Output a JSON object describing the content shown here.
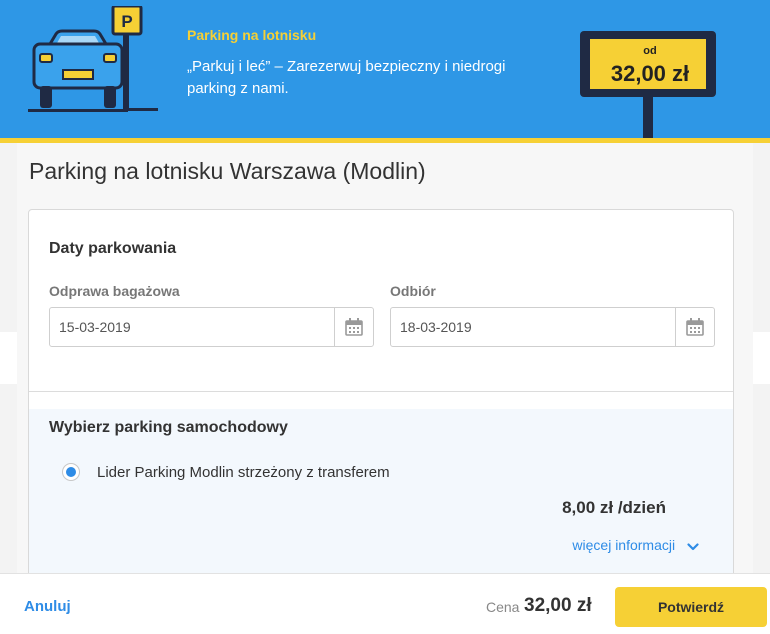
{
  "banner": {
    "title": "Parking na lotnisku",
    "description": "„Parkuj i leć” – Zarezerwuj bezpieczny i niedrogi parking z nami.",
    "sign_prefix": "od",
    "sign_price": "32,00 zł",
    "sign_letter": "P",
    "colors": {
      "background": "#2e97e6",
      "accent": "#f6d035"
    }
  },
  "page": {
    "title": "Parking na lotnisku Warszawa (Modlin)"
  },
  "dates": {
    "section_title": "Daty parkowania",
    "dropoff": {
      "label": "Odprawa bagażowa",
      "value": "15-03-2019",
      "icon": "calendar-icon"
    },
    "pickup": {
      "label": "Odbiór",
      "value": "18-03-2019",
      "icon": "calendar-icon"
    }
  },
  "parking": {
    "section_title": "Wybierz parking samochodowy",
    "option": {
      "label": "Lider Parking Modlin strzeżony z transferem",
      "selected": true,
      "price": "8,00 zł /dzień"
    },
    "more_info": "więcej informacji"
  },
  "footer": {
    "cancel": "Anuluj",
    "price_label": "Cena",
    "price_value": "32,00 zł",
    "confirm": "Potwierdź"
  }
}
